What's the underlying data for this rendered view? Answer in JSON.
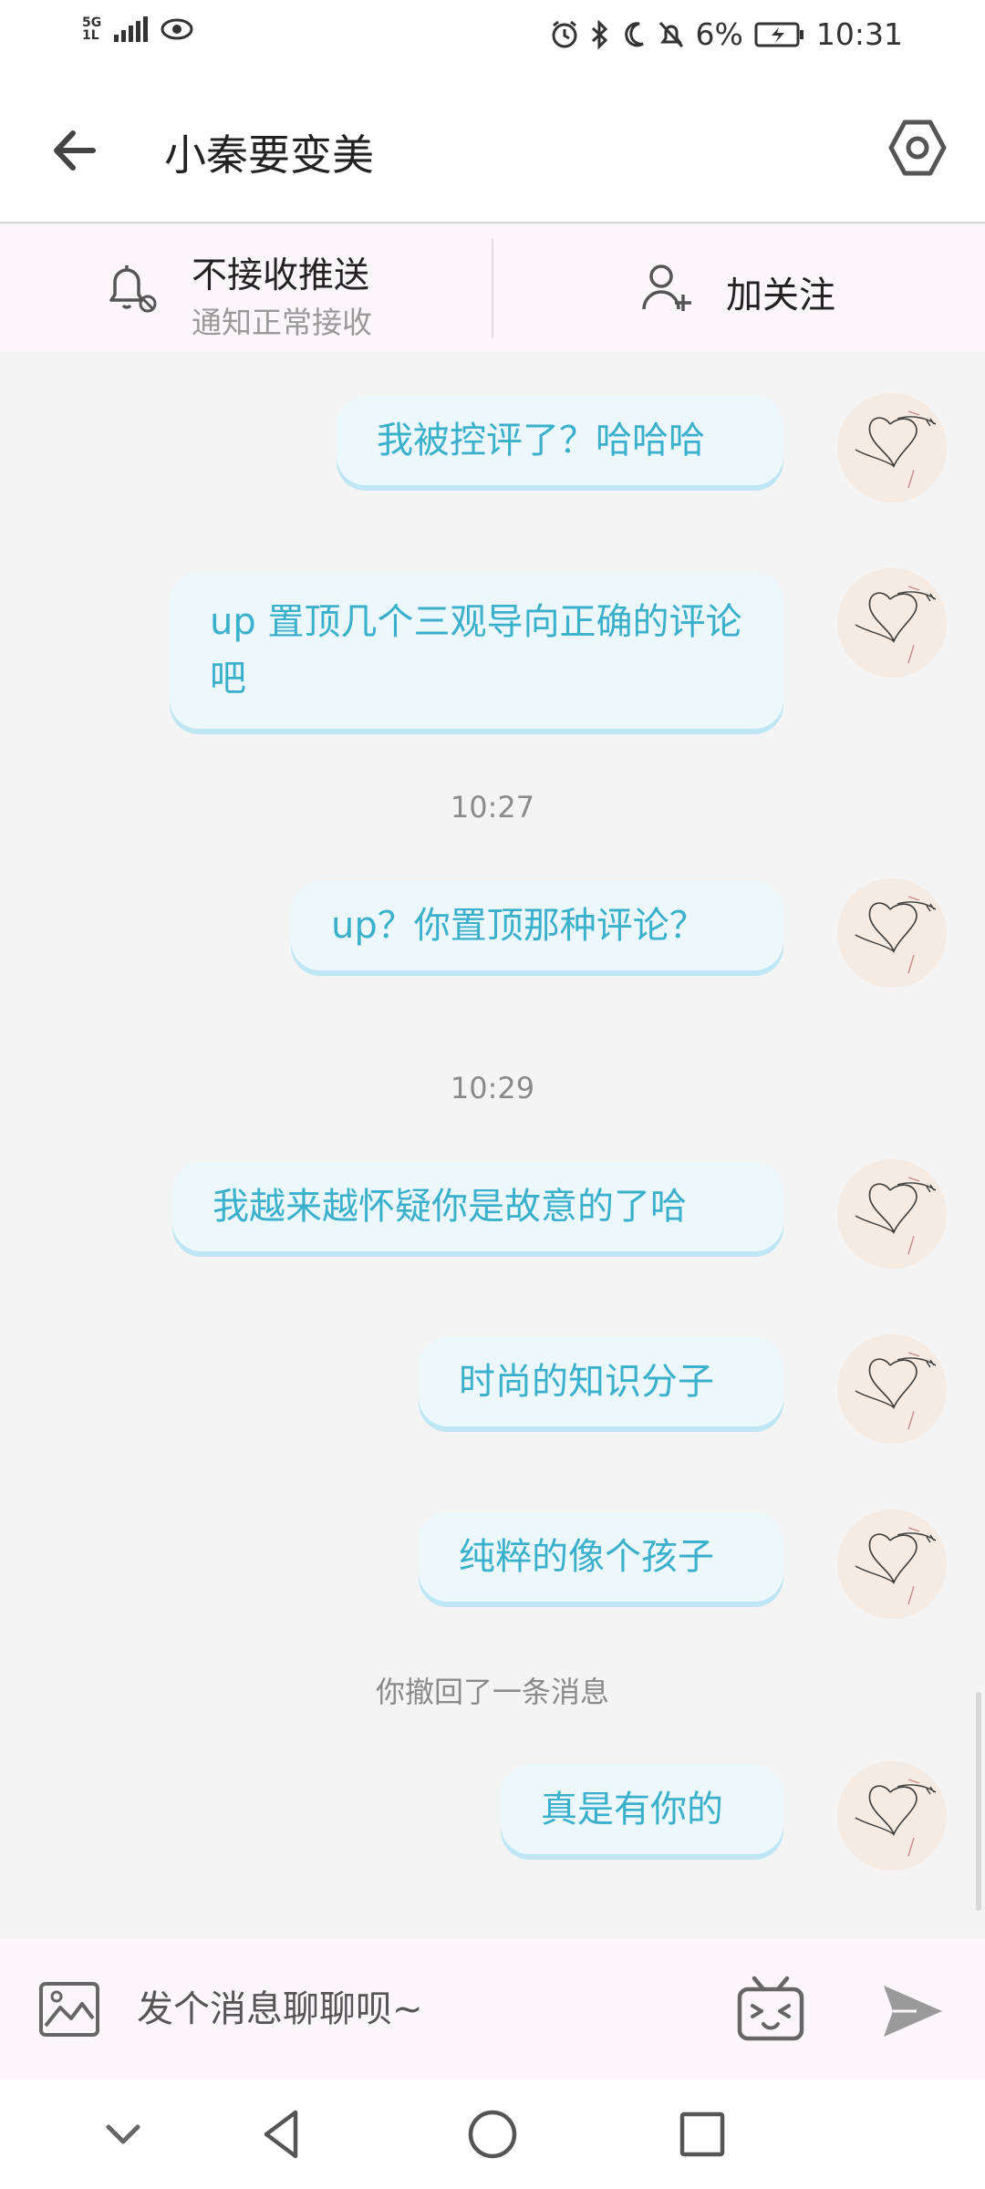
{
  "status_bar": {
    "network_top": "5G",
    "network_bottom": "1L",
    "battery_percent": "6%",
    "time": "10:31"
  },
  "header": {
    "title": "小秦要变美",
    "back_icon": "arrow-left-icon",
    "settings_icon": "hexagon-settings-icon"
  },
  "subbar": {
    "push_title": "不接收推送",
    "push_subtitle": "通知正常接收",
    "follow_label": "加关注"
  },
  "messages": {
    "m1": "我被控评了？哈哈哈",
    "m2": "up 置顶几个三观导向正确的评论吧",
    "time1": "10:27",
    "m3": "up？你置顶那种评论？",
    "time2": "10:29",
    "m4": "我越来越怀疑你是故意的了哈",
    "m5": "时尚的知识分子",
    "m6": "纯粹的像个孩子",
    "recall": "你撤回了一条消息",
    "m7": "真是有你的"
  },
  "input": {
    "placeholder": "发个消息聊聊呗~",
    "value": ""
  },
  "colors": {
    "bubble_bg": "#ecf8fc",
    "bubble_text": "#3ab0cc",
    "bubble_shadow": "#bfe6f4",
    "avatar_bg": "#f6ebe3",
    "subbar_bg": "#fbf6fa"
  }
}
